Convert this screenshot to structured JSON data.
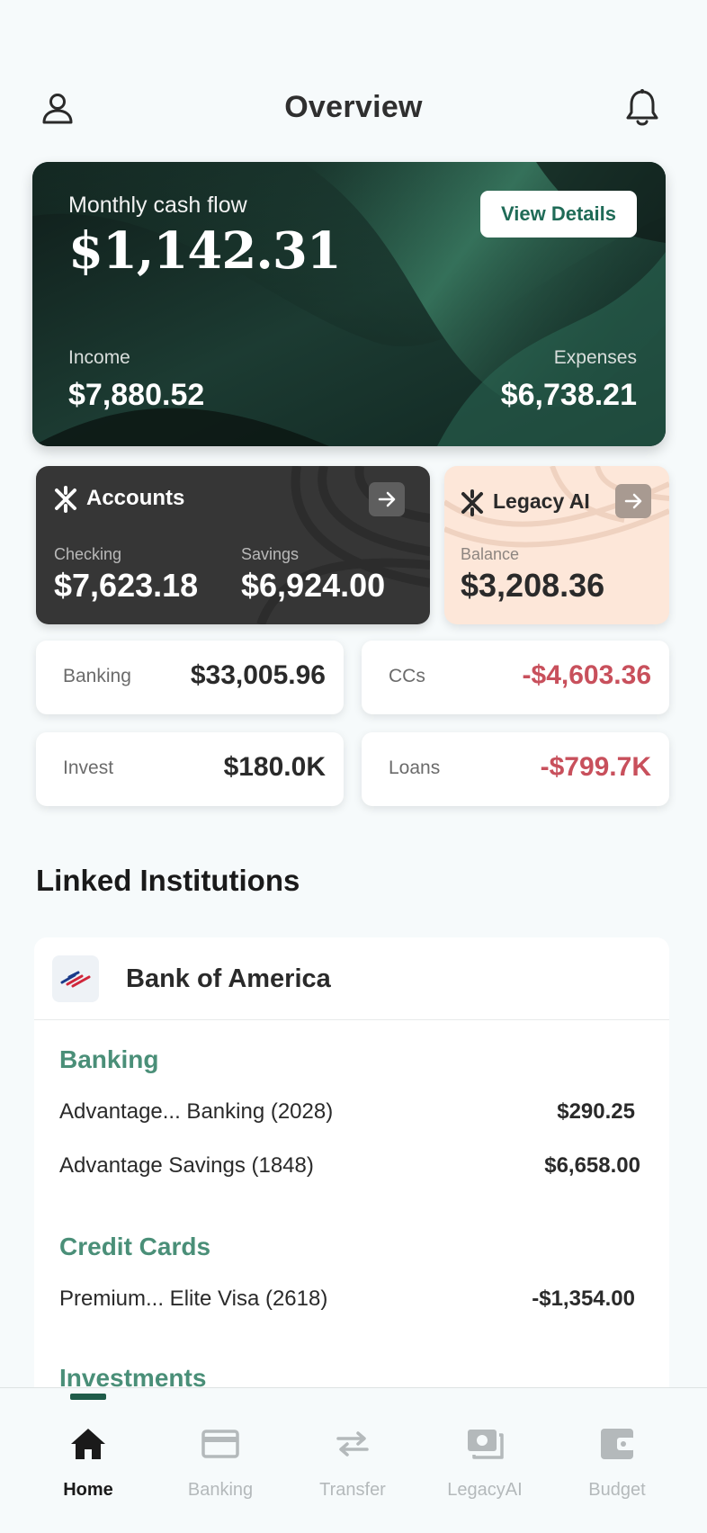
{
  "header": {
    "title": "Overview",
    "left_icon": "user-icon",
    "right_icon": "bell-icon"
  },
  "cashflow": {
    "label": "Monthly cash flow",
    "amount": "$1,142.31",
    "view_details": "View Details",
    "income_label": "Income",
    "income_amount": "$7,880.52",
    "expenses_label": "Expenses",
    "expenses_amount": "$6,738.21"
  },
  "accounts": {
    "title": "Accounts",
    "checking_label": "Checking",
    "checking_amount": "$7,623.18",
    "savings_label": "Savings",
    "savings_amount": "$6,924.00"
  },
  "legacy": {
    "title": "Legacy AI",
    "balance_label": "Balance",
    "balance_amount": "$3,208.36"
  },
  "tiles": [
    {
      "label": "Banking",
      "value": "$33,005.96"
    },
    {
      "label": "CCs",
      "value": "-$4,603.36"
    },
    {
      "label": "Invest",
      "value": "$180.0K"
    },
    {
      "label": "Loans",
      "value": "-$799.7K"
    }
  ],
  "linked": {
    "title": "Linked Institutions",
    "institution": "Bank of America",
    "groups": [
      {
        "title": "Banking",
        "accounts": [
          {
            "name": "Advantage... Banking (2028)",
            "amount": "$290.25"
          },
          {
            "name": "Advantage Savings (1848)",
            "amount": "$6,658.00"
          }
        ]
      },
      {
        "title": "Credit Cards",
        "accounts": [
          {
            "name": "Premium... Elite Visa  (2618)",
            "amount": "-$1,354.00"
          }
        ]
      },
      {
        "title": "Investments",
        "accounts": []
      }
    ]
  },
  "nav": {
    "items": [
      {
        "label": "Home",
        "icon": "home-icon",
        "active": true
      },
      {
        "label": "Banking",
        "icon": "card-icon",
        "active": false
      },
      {
        "label": "Transfer",
        "icon": "transfer-icon",
        "active": false
      },
      {
        "label": "LegacyAI",
        "icon": "money-icon",
        "active": false
      },
      {
        "label": "Budget",
        "icon": "wallet-icon",
        "active": false
      }
    ]
  },
  "colors": {
    "accent_green": "#1f6b57",
    "group_green": "#4a8f78",
    "negative_red": "#c8505c",
    "legacy_peach": "#fde7d9",
    "accounts_dark": "#363636"
  }
}
